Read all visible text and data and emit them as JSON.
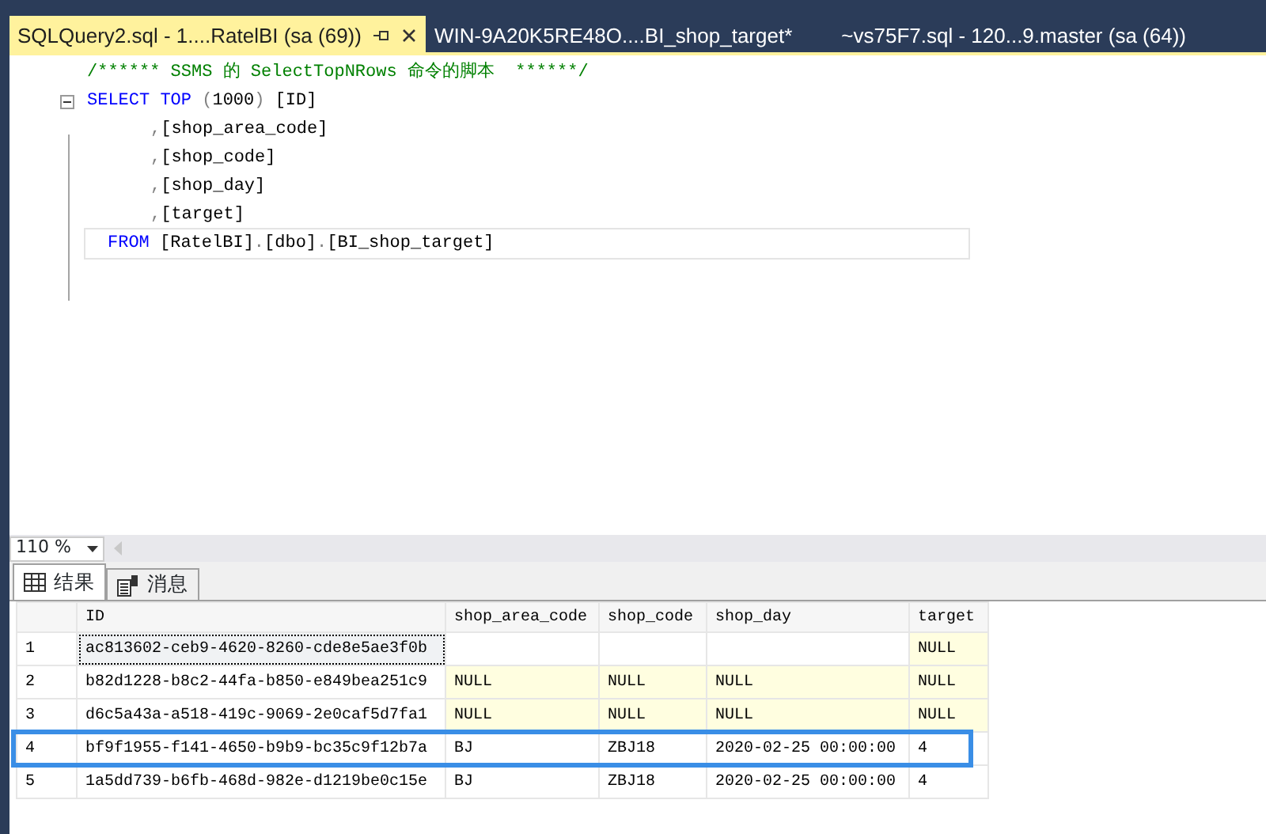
{
  "tabs": [
    {
      "label": "SQLQuery2.sql - 1....RatelBI (sa (69))",
      "selected": true
    },
    {
      "label": "WIN-9A20K5RE48O....BI_shop_target*",
      "selected": false
    },
    {
      "label": "~vs75F7.sql - 120...9.master (sa (64))",
      "selected": false
    }
  ],
  "editor": {
    "lines": [
      {
        "current": false,
        "tokens": [
          {
            "kind": "comment",
            "text": "/****** SSMS 的 SelectTopNRows 命令的脚本  ******/"
          }
        ]
      },
      {
        "current": false,
        "expanded": true,
        "tokens": [
          {
            "kind": "keyword",
            "text": "SELECT TOP"
          },
          {
            "kind": "punct",
            "text": " ("
          },
          {
            "kind": "plain",
            "text": "1000"
          },
          {
            "kind": "punct",
            "text": ")"
          },
          {
            "kind": "plain",
            "text": " [ID]"
          }
        ],
        "children": [
          {
            "current": false,
            "tokens": [
              {
                "kind": "punct",
                "text": ","
              },
              {
                "kind": "plain",
                "text": "[shop_area_code]"
              }
            ]
          },
          {
            "current": false,
            "tokens": [
              {
                "kind": "punct",
                "text": ","
              },
              {
                "kind": "plain",
                "text": "[shop_code]"
              }
            ]
          },
          {
            "current": false,
            "tokens": [
              {
                "kind": "punct",
                "text": ","
              },
              {
                "kind": "plain",
                "text": "[shop_day]"
              }
            ]
          },
          {
            "current": false,
            "tokens": [
              {
                "kind": "punct",
                "text": ","
              },
              {
                "kind": "plain",
                "text": "[target]"
              }
            ]
          }
        ]
      },
      {
        "current": true,
        "tokens": [
          {
            "kind": "keyword",
            "text": "FROM"
          },
          {
            "kind": "plain",
            "text": " [RatelBI]"
          },
          {
            "kind": "punct",
            "text": "."
          },
          {
            "kind": "plain",
            "text": "[dbo]"
          },
          {
            "kind": "punct",
            "text": "."
          },
          {
            "kind": "plain",
            "text": "[BI_shop_target]"
          }
        ]
      }
    ]
  },
  "zoom": {
    "value": "110 %"
  },
  "result_tabs": [
    {
      "label": "结果",
      "kind": "grid",
      "selected": true
    },
    {
      "label": "消息",
      "kind": "messages",
      "selected": false
    }
  ],
  "grid": {
    "columns": [
      "ID",
      "shop_area_code",
      "shop_code",
      "shop_day",
      "target"
    ],
    "rows": [
      {
        "number": "1",
        "highlighted": false,
        "cells": [
          {
            "kind": "value",
            "text": "ac813602-ceb9-4620-8260-cde8e5ae3f0b",
            "focused": true
          },
          {
            "kind": "empty"
          },
          {
            "kind": "empty"
          },
          {
            "kind": "empty"
          },
          {
            "kind": "null",
            "text": "NULL"
          }
        ]
      },
      {
        "number": "2",
        "highlighted": false,
        "cells": [
          {
            "kind": "value",
            "text": "b82d1228-b8c2-44fa-b850-e849bea251c9"
          },
          {
            "kind": "null",
            "text": "NULL"
          },
          {
            "kind": "null",
            "text": "NULL"
          },
          {
            "kind": "null",
            "text": "NULL"
          },
          {
            "kind": "null",
            "text": "NULL"
          }
        ]
      },
      {
        "number": "3",
        "highlighted": false,
        "cells": [
          {
            "kind": "value",
            "text": "d6c5a43a-a518-419c-9069-2e0caf5d7fa1"
          },
          {
            "kind": "null",
            "text": "NULL"
          },
          {
            "kind": "null",
            "text": "NULL"
          },
          {
            "kind": "null",
            "text": "NULL"
          },
          {
            "kind": "null",
            "text": "NULL"
          }
        ]
      },
      {
        "number": "4",
        "highlighted": true,
        "cells": [
          {
            "kind": "value",
            "text": "bf9f1955-f141-4650-b9b9-bc35c9f12b7a"
          },
          {
            "kind": "value",
            "text": "BJ"
          },
          {
            "kind": "value",
            "text": "ZBJ18"
          },
          {
            "kind": "value",
            "text": "2020-02-25 00:00:00"
          },
          {
            "kind": "value",
            "text": "4"
          }
        ]
      },
      {
        "number": "5",
        "highlighted": false,
        "cells": [
          {
            "kind": "value",
            "text": "1a5dd739-b6fb-468d-982e-d1219be0c15e"
          },
          {
            "kind": "value",
            "text": "BJ"
          },
          {
            "kind": "value",
            "text": "ZBJ18"
          },
          {
            "kind": "value",
            "text": "2020-02-25 00:00:00"
          },
          {
            "kind": "value",
            "text": "4"
          }
        ]
      }
    ]
  }
}
